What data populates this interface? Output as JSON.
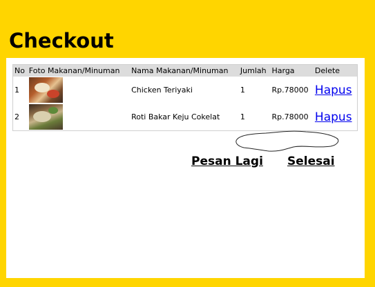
{
  "page": {
    "title": "Checkout"
  },
  "cart": {
    "columns": [
      "No",
      "Foto Makanan/Minuman",
      "Nama Makanan/Minuman",
      "Jumlah",
      "Harga",
      "Delete"
    ],
    "rows": [
      {
        "no": "1",
        "photo_icon": "food-photo-chicken-teriyaki",
        "name": "Chicken Teriyaki",
        "qty": "1",
        "price": "Rp.78000",
        "delete": "Hapus"
      },
      {
        "no": "2",
        "photo_icon": "food-photo-roti-bakar",
        "name": "Roti Bakar Keju Cokelat",
        "qty": "1",
        "price": "Rp.78000",
        "delete": "Hapus"
      }
    ]
  },
  "actions": {
    "order_again": "Pesan Lagi",
    "finish": "Selesai"
  },
  "colors": {
    "background": "#ffd500",
    "panel": "#ffffff",
    "header_row": "#dcdcdc",
    "link": "#0000ee"
  }
}
